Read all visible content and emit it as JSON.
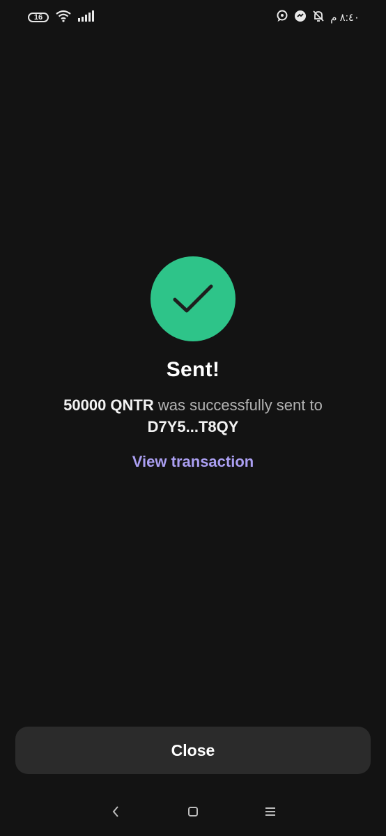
{
  "status_bar": {
    "battery": "16",
    "time": "٨:٤٠ م"
  },
  "result": {
    "title": "Sent!",
    "amount": "50000 QNTR",
    "middle_text": " was successfully sent to ",
    "recipient": "D7Y5...T8QY",
    "link_label": "View transaction"
  },
  "footer": {
    "close_label": "Close"
  },
  "colors": {
    "background": "#131313",
    "success": "#2ec489",
    "link": "#ab9ff2",
    "button": "#2b2b2b"
  },
  "icons": [
    "check-icon",
    "wifi-icon",
    "signal-icon",
    "battery-icon",
    "bell-off-icon",
    "chat-icon",
    "back-icon",
    "home-icon",
    "menu-icon"
  ]
}
